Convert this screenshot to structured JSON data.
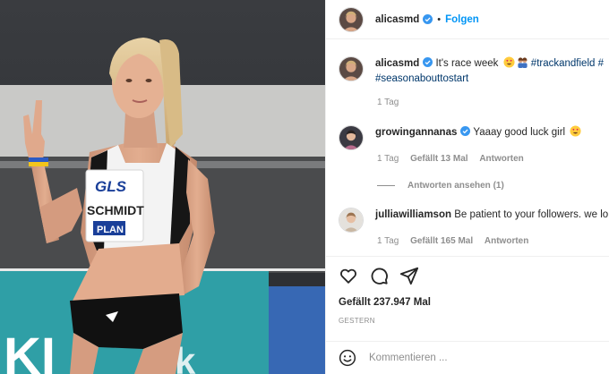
{
  "header": {
    "username": "alicasmd",
    "separator": "•",
    "follow_label": "Folgen"
  },
  "photo": {
    "bib_sponsor": "GLS",
    "bib_name": "SCHMIDT",
    "bib_footer": "PLAN",
    "banner_letters": "KI"
  },
  "caption": {
    "username": "alicasmd",
    "text": "It's race week",
    "hashtag1": "#trackandfield",
    "hashtag_cut": "#",
    "hashtag2": "#seasonabouttostart",
    "time": "1 Tag"
  },
  "comments": [
    {
      "username": "growingannanas",
      "text": "Yaaay good luck girl",
      "time": "1 Tag",
      "likes": "Gefällt 13 Mal",
      "reply_label": "Antworten",
      "view_replies": "Antworten ansehen (1)"
    },
    {
      "username": "julliawilliamson",
      "text": "Be patient to your followers. we lo",
      "time": "1 Tag",
      "likes": "Gefällt 165 Mal",
      "reply_label": "Antworten"
    }
  ],
  "icons": {
    "like": "heart-icon",
    "comment": "comment-icon",
    "share": "share-icon",
    "emoji": "emoji-icon",
    "verified": "verified-badge-icon"
  },
  "stats": {
    "likes": "Gefällt 237.947 Mal",
    "date": "GESTERN"
  },
  "comment_box": {
    "placeholder": "Kommentieren ..."
  },
  "colors": {
    "accent": "#0095f6",
    "hashtag": "#00376b",
    "muted": "#8e8e8e",
    "border": "#efefef"
  }
}
